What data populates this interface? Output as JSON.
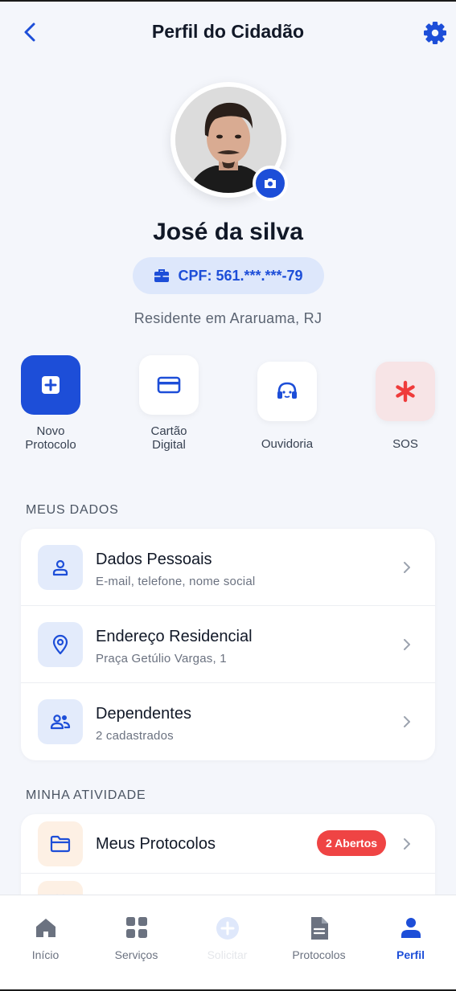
{
  "header": {
    "title": "Perfil do Cidadão"
  },
  "profile": {
    "name": "José da silva",
    "cpf": "CPF: 561.***.***-79",
    "residence": "Residente em Araruama, RJ"
  },
  "quick_actions": [
    {
      "label_line1": "Novo",
      "label_line2": "Protocolo",
      "icon": "plus-square-icon"
    },
    {
      "label_line1": "Cartão",
      "label_line2": "Digital",
      "icon": "credit-card-icon"
    },
    {
      "label_line1": "Ouvidoria",
      "icon": "headset-icon"
    },
    {
      "label_line1": "SOS",
      "icon": "asterisk-icon"
    }
  ],
  "meus_dados": {
    "section_title": "MEUS DADOS",
    "items": [
      {
        "title": "Dados Pessoais",
        "subtitle": "E-mail, telefone, nome social",
        "icon": "person-icon"
      },
      {
        "title": "Endereço Residencial",
        "subtitle": "Praça Getúlio Vargas, 1",
        "icon": "location-pin-icon"
      },
      {
        "title": "Dependentes",
        "subtitle": "2 cadastrados",
        "icon": "people-icon"
      }
    ]
  },
  "minha_atividade": {
    "section_title": "MINHA ATIVIDADE",
    "items": [
      {
        "title": "Meus Protocolos",
        "badge": "2 Abertos",
        "icon": "folder-icon"
      },
      {
        "title": "",
        "icon": "calendar-icon"
      }
    ]
  },
  "bottom_nav": [
    {
      "label": "Início",
      "icon": "home-icon",
      "state": "normal"
    },
    {
      "label": "Serviços",
      "icon": "grid-icon",
      "state": "normal"
    },
    {
      "label": "Solicitar",
      "icon": "plus-circle-icon",
      "state": "disabled"
    },
    {
      "label": "Protocolos",
      "icon": "document-icon",
      "state": "normal"
    },
    {
      "label": "Perfil",
      "icon": "person-icon",
      "state": "active"
    }
  ],
  "colors": {
    "primary": "#1d4ed8",
    "background": "#f4f6fb",
    "danger": "#ef4444",
    "sos_bg": "#f7e4e6"
  }
}
